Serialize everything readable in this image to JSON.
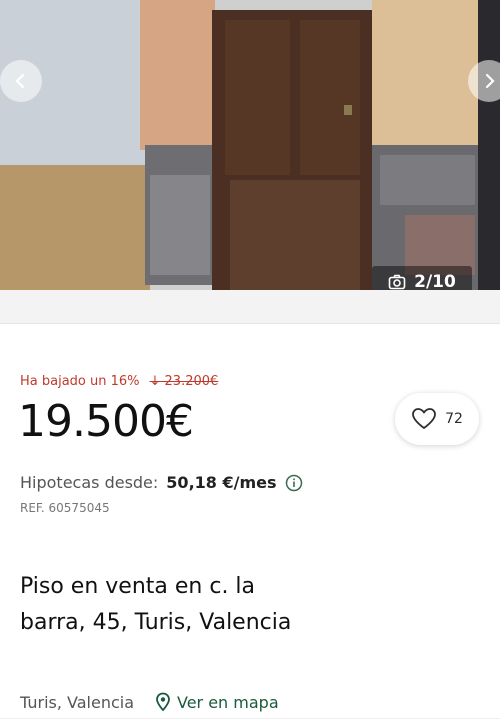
{
  "gallery": {
    "counter_text": "2/10",
    "prev_icon": "chevron-left-icon",
    "next_icon": "chevron-right-icon",
    "camera_icon": "camera-icon"
  },
  "listing": {
    "price_drop_text": "Ha bajado un 16%",
    "old_price": "↓ 23.200€",
    "price": "19.500€",
    "favorites_count": "72",
    "mortgage_label": "Hipotecas desde:",
    "mortgage_value": "50,18 €/mes",
    "ref": "REF. 60575045",
    "title": "Piso en venta en c. la barra, 45, Turis, Valencia",
    "location": "Turis, Valencia",
    "map_link": "Ver en mapa"
  },
  "colors": {
    "price_drop": "#c03a2b",
    "map_link": "#1a5a3c"
  }
}
